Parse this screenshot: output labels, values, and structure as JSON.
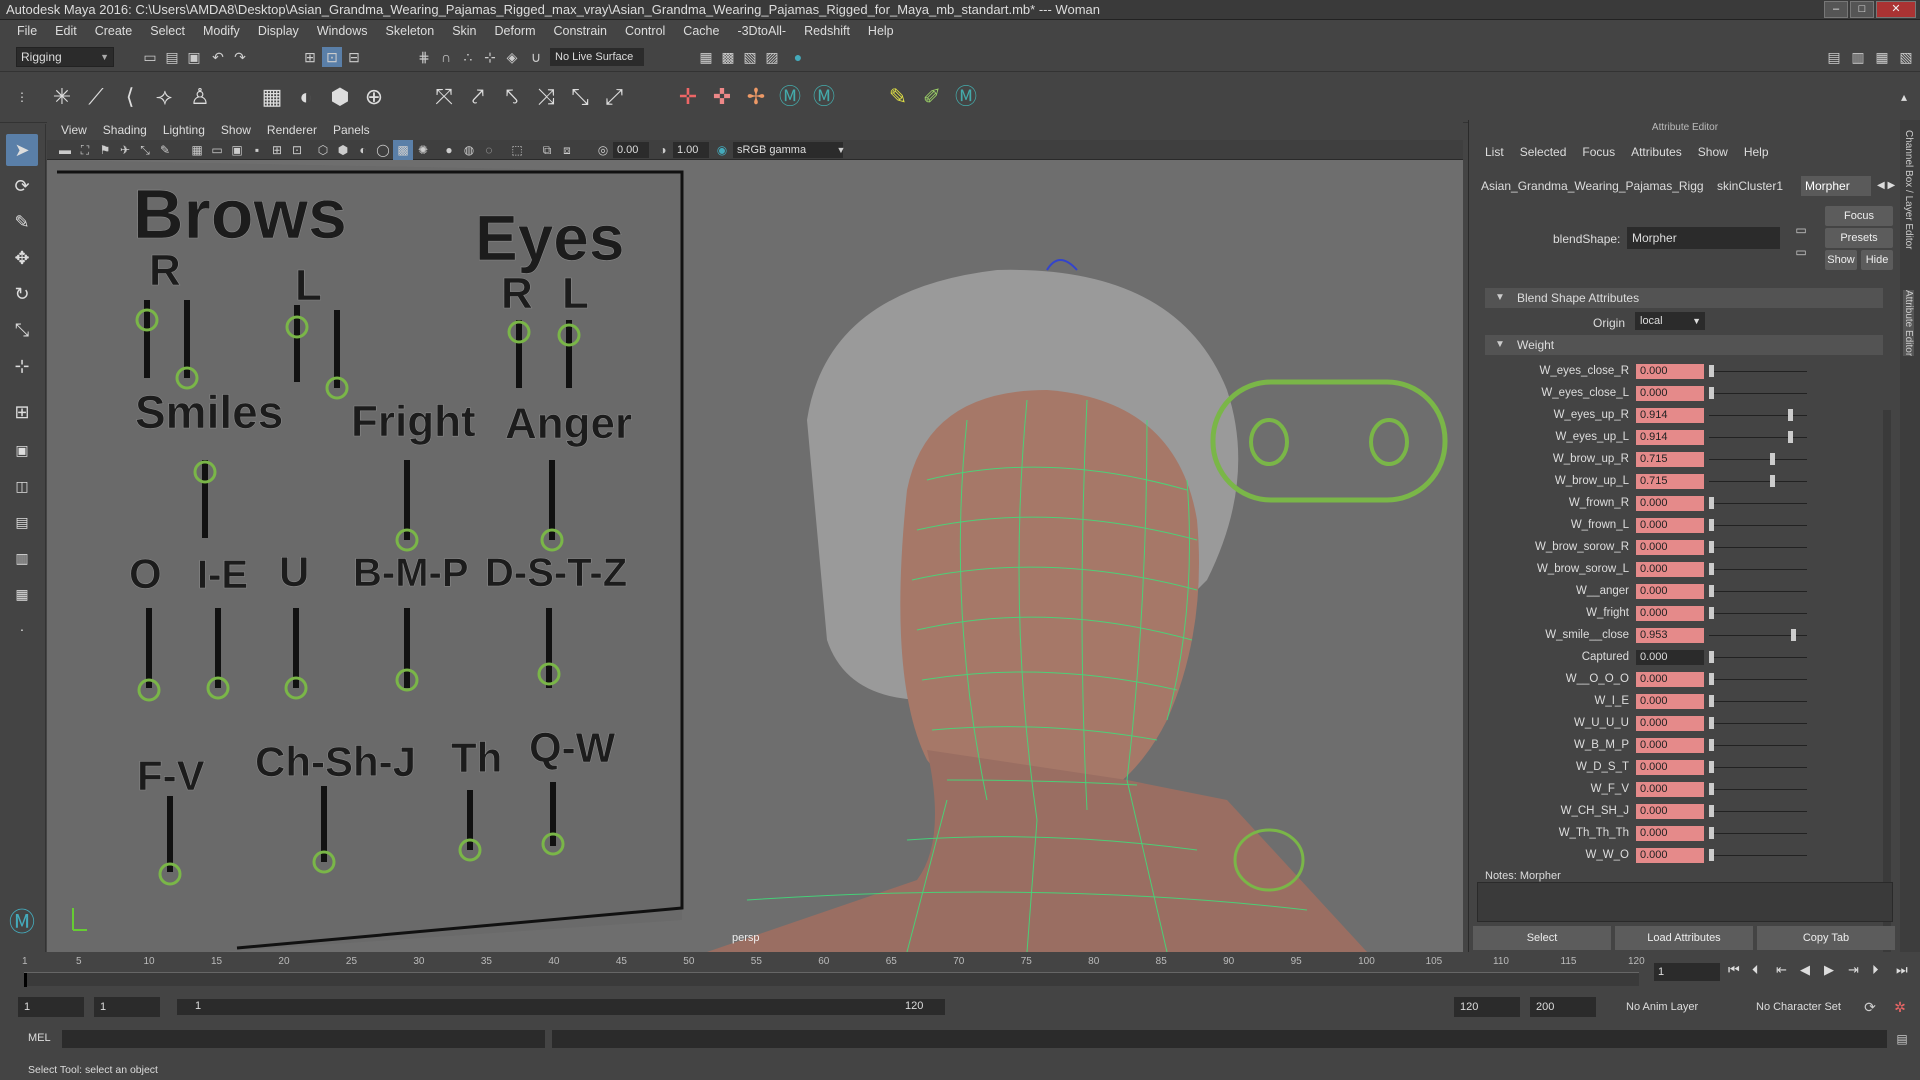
{
  "title": "Autodesk Maya 2016: C:\\Users\\AMDA8\\Desktop\\Asian_Grandma_Wearing_Pajamas_Rigged_max_vray\\Asian_Grandma_Wearing_Pajamas_Rigged_for_Maya_mb_standart.mb*   ---   Woman",
  "window_buttons": {
    "min": "–",
    "max": "□",
    "close": "✕"
  },
  "menus": [
    "File",
    "Edit",
    "Create",
    "Select",
    "Modify",
    "Display",
    "Windows",
    "Skeleton",
    "Skin",
    "Deform",
    "Constrain",
    "Control",
    "Cache",
    "-3DtoAll-",
    "Redshift",
    "Help"
  ],
  "mode": "Rigging",
  "live_surface": "No Live Surface",
  "viewport": {
    "menus": [
      "View",
      "Shading",
      "Lighting",
      "Show",
      "Renderer",
      "Panels"
    ],
    "exposure": "0.00",
    "gamma": "1.00",
    "color_space": "sRGB gamma",
    "camera": "persp"
  },
  "board": {
    "brows": "Brows",
    "brows_r": "R",
    "brows_l": "L",
    "eyes": "Eyes",
    "eyes_r": "R",
    "eyes_l": "L",
    "smiles": "Smiles",
    "fright": "Fright",
    "anger": "Anger",
    "o": "O",
    "ie": "I-E",
    "u": "U",
    "bmp": "B-M-P",
    "dstz": "D-S-T-Z",
    "fv": "F-V",
    "chshj": "Ch-Sh-J",
    "th": "Th",
    "qw": "Q-W"
  },
  "attribute_editor": {
    "title": "Attribute Editor",
    "menus": [
      "List",
      "Selected",
      "Focus",
      "Attributes",
      "Show",
      "Help"
    ],
    "tabs": [
      "Asian_Grandma_Wearing_Pajamas_Rigged",
      "skinCluster1",
      "Morpher"
    ],
    "focus": "Focus",
    "presets": "Presets",
    "show": "Show",
    "hide": "Hide",
    "blendshape_label": "blendShape:",
    "blendshape_value": "Morpher",
    "section_blend": "Blend Shape Attributes",
    "origin_label": "Origin",
    "origin_value": "local",
    "section_weight": "Weight",
    "weights": [
      {
        "name": "W_eyes_close_R",
        "value": "0.000",
        "level": 0
      },
      {
        "name": "W_eyes_close_L",
        "value": "0.000",
        "level": 0
      },
      {
        "name": "W_eyes_up_R",
        "value": "0.914",
        "level": 0.914
      },
      {
        "name": "W_eyes_up_L",
        "value": "0.914",
        "level": 0.914
      },
      {
        "name": "W_brow_up_R",
        "value": "0.715",
        "level": 0.715
      },
      {
        "name": "W_brow_up_L",
        "value": "0.715",
        "level": 0.715
      },
      {
        "name": "W_frown_R",
        "value": "0.000",
        "level": 0
      },
      {
        "name": "W_frown_L",
        "value": "0.000",
        "level": 0
      },
      {
        "name": "W_brow_sorow_R",
        "value": "0.000",
        "level": 0
      },
      {
        "name": "W_brow_sorow_L",
        "value": "0.000",
        "level": 0
      },
      {
        "name": "W__anger",
        "value": "0.000",
        "level": 0
      },
      {
        "name": "W_fright",
        "value": "0.000",
        "level": 0
      },
      {
        "name": "W_smile__close",
        "value": "0.953",
        "level": 0.953
      },
      {
        "name": "Captured",
        "value": "0.000",
        "level": 0,
        "captured": true
      },
      {
        "name": "W__O_O_O",
        "value": "0.000",
        "level": 0
      },
      {
        "name": "W_I_E",
        "value": "0.000",
        "level": 0
      },
      {
        "name": "W_U_U_U",
        "value": "0.000",
        "level": 0
      },
      {
        "name": "W_B_M_P",
        "value": "0.000",
        "level": 0
      },
      {
        "name": "W_D_S_T",
        "value": "0.000",
        "level": 0
      },
      {
        "name": "W_F_V",
        "value": "0.000",
        "level": 0
      },
      {
        "name": "W_CH_SH_J",
        "value": "0.000",
        "level": 0
      },
      {
        "name": "W_Th_Th_Th",
        "value": "0.000",
        "level": 0
      },
      {
        "name": "W_W_O",
        "value": "0.000",
        "level": 0
      }
    ],
    "notes_label": "Notes:  Morpher",
    "btn_select": "Select",
    "btn_load": "Load Attributes",
    "btn_copy": "Copy Tab"
  },
  "side_tabs": [
    "Channel Box / Layer Editor",
    "Attribute Editor"
  ],
  "timeline": {
    "ticks": [
      "1",
      "5",
      "10",
      "15",
      "20",
      "25",
      "30",
      "35",
      "40",
      "45",
      "50",
      "55",
      "60",
      "65",
      "70",
      "75",
      "80",
      "85",
      "90",
      "95",
      "100",
      "105",
      "110",
      "115",
      "120"
    ],
    "current_frame": "1",
    "range_start": "1",
    "playback_start": "1",
    "slider_start": "1",
    "slider_end": "120",
    "playback_end": "120",
    "range_end": "200",
    "anim_layer": "No Anim Layer",
    "character_set": "No Character Set"
  },
  "cmd_label": "MEL",
  "help_text": "Select Tool: select an object"
}
